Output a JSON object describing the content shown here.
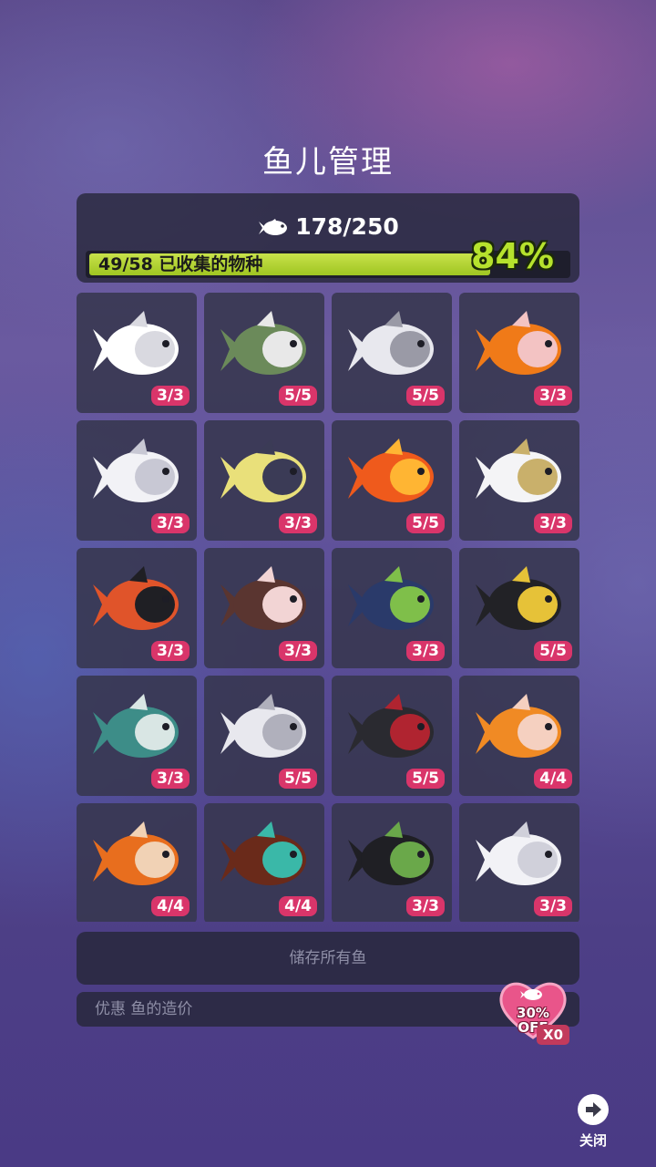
{
  "title": "鱼儿管理",
  "stats": {
    "fish_count": "178/250",
    "fish_icon": "fish-icon",
    "species_label": "49/58 已收集的物种",
    "species_progress": 0.84,
    "percent": "84%"
  },
  "fish_cards": [
    {
      "icon": "skeleton-fish-icon",
      "count": "3/3",
      "colors": [
        "#ffffff",
        "#d9d9e0"
      ]
    },
    {
      "icon": "clownfish-camo-icon",
      "count": "5/5",
      "colors": [
        "#6b8a5a",
        "#e8e8e8"
      ]
    },
    {
      "icon": "ghost-fish-icon",
      "count": "5/5",
      "colors": [
        "#e8e8ee",
        "#9a9aa6"
      ]
    },
    {
      "icon": "pumpkin-fish-icon",
      "count": "3/3",
      "colors": [
        "#f07a18",
        "#f3c3c3"
      ]
    },
    {
      "icon": "ghost-wisp-fish-icon",
      "count": "3/3",
      "colors": [
        "#f2f2f6",
        "#c8c8d4"
      ]
    },
    {
      "icon": "constellation-fish-icon",
      "count": "3/3",
      "colors": [
        "#e9e07a",
        "#3b3b56"
      ]
    },
    {
      "icon": "fire-fish-icon",
      "count": "5/5",
      "colors": [
        "#ef5a1c",
        "#ffb533"
      ]
    },
    {
      "icon": "robot-puffer-icon",
      "count": "3/3",
      "colors": [
        "#f4f4f6",
        "#c9b06b"
      ]
    },
    {
      "icon": "bat-fish-icon",
      "count": "3/3",
      "colors": [
        "#e0542a",
        "#1f1f24"
      ]
    },
    {
      "icon": "reaper-fish-icon",
      "count": "3/3",
      "colors": [
        "#5a3530",
        "#f2d4d4"
      ]
    },
    {
      "icon": "witch-fish-icon",
      "count": "3/3",
      "colors": [
        "#2a3a6a",
        "#7fbf4a"
      ]
    },
    {
      "icon": "shadow-fish-icon",
      "count": "5/5",
      "colors": [
        "#222226",
        "#e6c238"
      ]
    },
    {
      "icon": "mummy-fish-icon",
      "count": "3/3",
      "colors": [
        "#3d8d88",
        "#d9e6e4"
      ]
    },
    {
      "icon": "angler-ghost-icon",
      "count": "5/5",
      "colors": [
        "#e8e8ee",
        "#b0b0bc"
      ]
    },
    {
      "icon": "rose-angler-icon",
      "count": "5/5",
      "colors": [
        "#2a2a30",
        "#b02430"
      ]
    },
    {
      "icon": "autumn-leaf-fish-icon",
      "count": "4/4",
      "colors": [
        "#f08a24",
        "#f5d0c0"
      ]
    },
    {
      "icon": "pumpkin-carriage-icon",
      "count": "4/4",
      "colors": [
        "#e86e1e",
        "#f1d2b5"
      ]
    },
    {
      "icon": "spider-egg-fish-icon",
      "count": "4/4",
      "colors": [
        "#6a2a1a",
        "#3ab8a8"
      ]
    },
    {
      "icon": "witch-frog-icon",
      "count": "3/3",
      "colors": [
        "#1f1f24",
        "#6aa84a"
      ]
    },
    {
      "icon": "ghost-spirit-icon",
      "count": "3/3",
      "colors": [
        "#f2f2f6",
        "#d0d0da"
      ]
    }
  ],
  "store_all": "储存所有鱼",
  "discount_label": "优惠 鱼的造价",
  "offer": {
    "icon": "heart-fish-icon",
    "percent": "30%",
    "off": "OFF",
    "multiplier": "X0",
    "color": "#e9558a"
  },
  "close": {
    "icon": "arrow-right-icon",
    "label": "关闭"
  }
}
